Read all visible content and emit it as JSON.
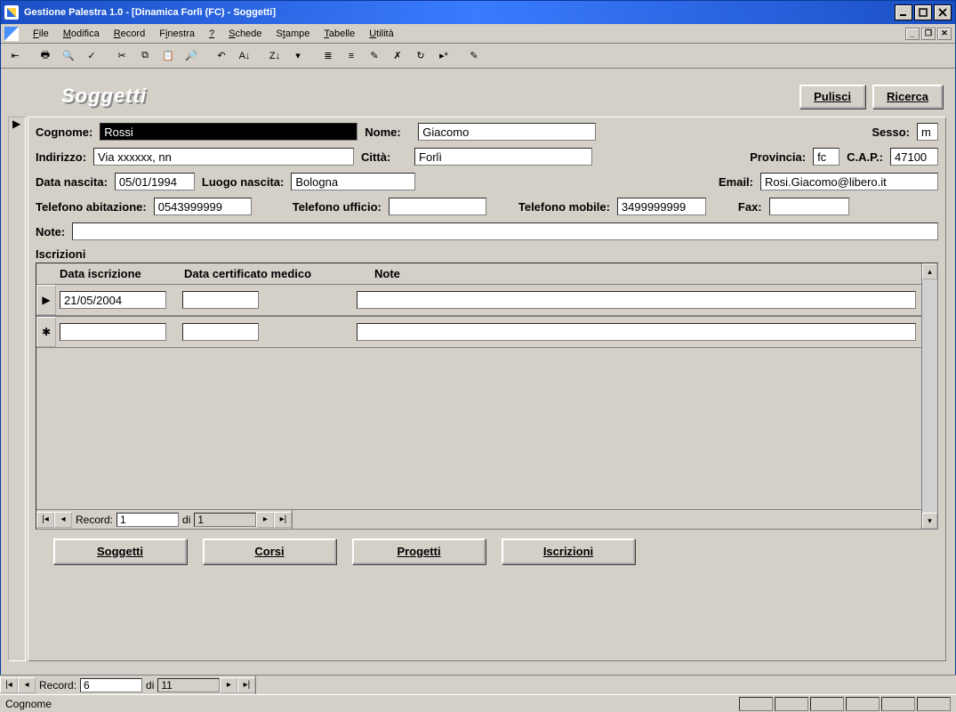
{
  "window": {
    "title": "Gestione Palestra 1.0 - [Dinamica Forlì (FC) - Soggetti]"
  },
  "menu": {
    "items": [
      {
        "label": "File",
        "u": "F"
      },
      {
        "label": "Modifica",
        "u": "M"
      },
      {
        "label": "Record",
        "u": "R"
      },
      {
        "label": "Finestra",
        "u": "i"
      },
      {
        "label": "?",
        "u": "?"
      },
      {
        "label": "Schede",
        "u": "S"
      },
      {
        "label": "Stampe",
        "u": "t"
      },
      {
        "label": "Tabelle",
        "u": "T"
      },
      {
        "label": "Utilità",
        "u": "U"
      }
    ]
  },
  "toolbar_icons": [
    "back-icon",
    "print-icon",
    "preview-icon",
    "spell-icon",
    "cut-icon",
    "copy-icon",
    "paste-icon",
    "find-icon",
    "undo-icon",
    "sort-asc-icon",
    "sort-desc-icon",
    "filter-form-icon",
    "filter-sel-icon",
    "filter-excl-icon",
    "filter-adv-icon",
    "remove-filter-icon",
    "refresh-icon",
    "new-record-icon",
    "edit-icon"
  ],
  "page": {
    "title": "Soggetti"
  },
  "buttons": {
    "pulisci": "Pulisci",
    "ricerca": "Ricerca",
    "soggetti": "Soggetti",
    "corsi": "Corsi",
    "progetti": "Progetti",
    "iscrizioni": "Iscrizioni"
  },
  "fields": {
    "cognome_label": "Cognome:",
    "cognome": "Rossi",
    "nome_label": "Nome:",
    "nome": "Giacomo",
    "sesso_label": "Sesso:",
    "sesso": "m",
    "indirizzo_label": "Indirizzo:",
    "indirizzo": "Via xxxxxx, nn",
    "citta_label": "Città:",
    "citta": "Forlì",
    "provincia_label": "Provincia:",
    "provincia": "fc",
    "cap_label": "C.A.P.:",
    "cap": "47100",
    "data_nascita_label": "Data nascita:",
    "data_nascita": "05/01/1994",
    "luogo_nascita_label": "Luogo nascita:",
    "luogo_nascita": "Bologna",
    "email_label": "Email:",
    "email": "Rosi.Giacomo@libero.it",
    "tel_ab_label": "Telefono abitazione:",
    "tel_ab": "0543999999",
    "tel_uf_label": "Telefono ufficio:",
    "tel_uf": "",
    "tel_mob_label": "Telefono mobile:",
    "tel_mob": "3499999999",
    "fax_label": "Fax:",
    "fax": "",
    "note_label": "Note:",
    "note": ""
  },
  "sub": {
    "title": "Iscrizioni",
    "headers": {
      "data_iscr": "Data iscrizione",
      "data_cert": "Data certificato medico",
      "note": "Note"
    },
    "rows": [
      {
        "data_iscr": "21/05/2004",
        "data_cert": "",
        "note": ""
      },
      {
        "data_iscr": "",
        "data_cert": "",
        "note": ""
      }
    ],
    "nav": {
      "label": "Record:",
      "current": "1",
      "of_label": "di",
      "total": "1"
    }
  },
  "outer_nav": {
    "label": "Record:",
    "current": "6",
    "of_label": "di",
    "total": "11"
  },
  "status": {
    "text": "Cognome"
  }
}
